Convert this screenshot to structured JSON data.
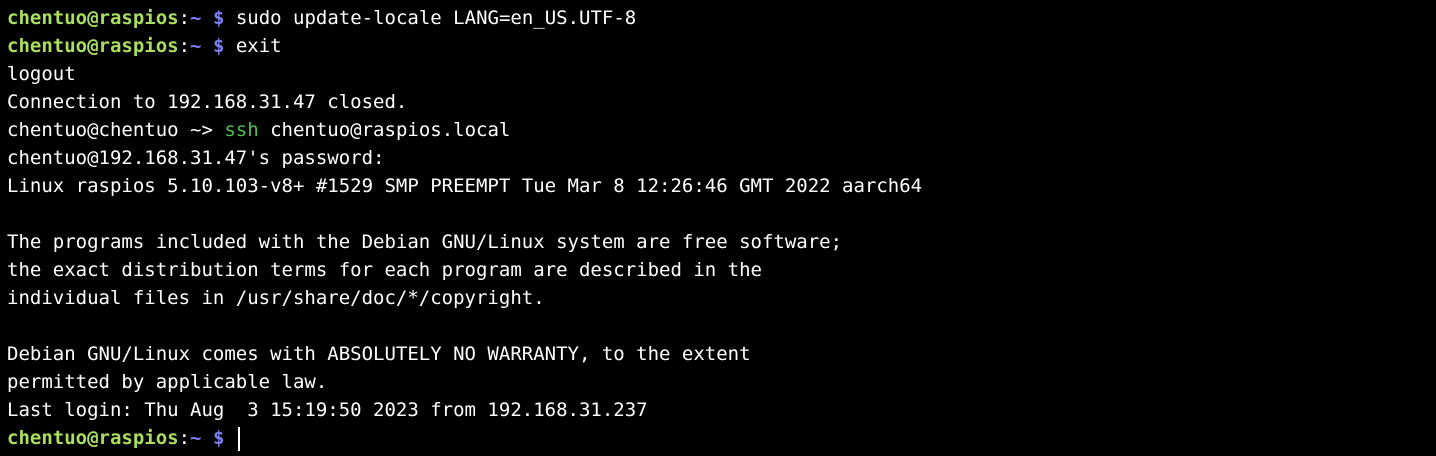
{
  "terminal": {
    "colors": {
      "background": "#000000",
      "text": "#ffffff",
      "prompt_user": "#a9df5f",
      "prompt_path": "#7c80f5",
      "command_highlight": "#4fc04f"
    },
    "remote_prompt": {
      "user_host": "chentuo@raspios",
      "sep": ":",
      "path": "~",
      "symbol": "$"
    },
    "local_prompt": {
      "text": "chentuo@chentuo ~> "
    },
    "lines": {
      "l01_cmd": " sudo update-locale LANG=en_US.UTF-8",
      "l02_cmd": " exit",
      "l03": "logout",
      "l04": "Connection to 192.168.31.47 closed.",
      "l05_cmd_name": "ssh",
      "l05_cmd_args": " chentuo@raspios.local",
      "l06": "chentuo@192.168.31.47's password:",
      "l07": "Linux raspios 5.10.103-v8+ #1529 SMP PREEMPT Tue Mar 8 12:26:46 GMT 2022 aarch64",
      "l08": "",
      "l09": "The programs included with the Debian GNU/Linux system are free software;",
      "l10": "the exact distribution terms for each program are described in the",
      "l11": "individual files in /usr/share/doc/*/copyright.",
      "l12": "",
      "l13": "Debian GNU/Linux comes with ABSOLUTELY NO WARRANTY, to the extent",
      "l14": "permitted by applicable law.",
      "l15": "Last login: Thu Aug  3 15:19:50 2023 from 192.168.31.237",
      "l16_cmd": " "
    }
  }
}
